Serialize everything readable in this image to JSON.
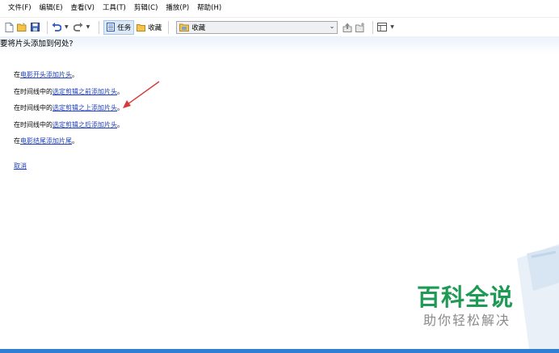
{
  "menu": [
    "文件(F)",
    "编辑(E)",
    "查看(V)",
    "工具(T)",
    "剪辑(C)",
    "播放(P)",
    "帮助(H)"
  ],
  "toolbar": {
    "tasks_label": "任务",
    "favorites_label": "收藏",
    "combo_value": "收藏"
  },
  "content": {
    "question": "要将片头添加到何处?",
    "options": [
      {
        "prefix": "在",
        "link": "电影开头添加片头",
        "suffix": "。"
      },
      {
        "prefix": "在时间线中的",
        "link": "选定剪辑之前添加片头",
        "suffix": "。"
      },
      {
        "prefix": "在时间线中的",
        "link": "选定剪辑之上添加片头",
        "suffix": "。"
      },
      {
        "prefix": "在时间线中的",
        "link": "选定剪辑之后添加片头",
        "suffix": "。"
      },
      {
        "prefix": "在",
        "link": "电影结尾添加片尾",
        "suffix": "。"
      }
    ],
    "cancel": "取消"
  },
  "watermark": {
    "title": "百科全说",
    "subtitle": "助你轻松解决"
  },
  "colors": {
    "link": "#1f3fb8",
    "annotation_arrow": "#d63a3a",
    "watermark_green": "#1f9a54",
    "status_bar": "#2f7fd4"
  }
}
